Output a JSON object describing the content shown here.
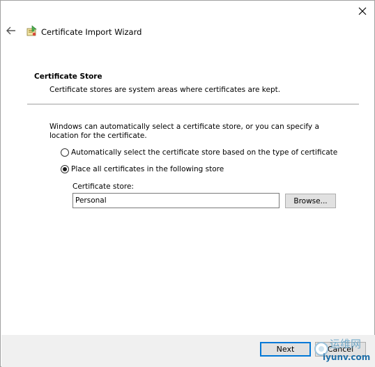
{
  "window": {
    "title": "Certificate Import Wizard",
    "close_icon": "close-icon",
    "back_icon": "back-arrow-icon",
    "wizard_icon": "certificate-wizard-icon"
  },
  "section": {
    "heading": "Certificate Store",
    "description": "Certificate stores are system areas where certificates are kept."
  },
  "body": {
    "intro": "Windows can automatically select a certificate store, or you can specify a location for the certificate.",
    "options": [
      {
        "label": "Automatically select the certificate store based on the type of certificate",
        "selected": false
      },
      {
        "label": "Place all certificates in the following store",
        "selected": true
      }
    ],
    "store_label": "Certificate store:",
    "store_value": "Personal",
    "browse_label": "Browse..."
  },
  "footer": {
    "next_label": "Next",
    "cancel_label": "Cancel"
  },
  "watermark": {
    "text": "运维网",
    "url": "iyunv.com"
  },
  "colors": {
    "accent": "#0078d7",
    "footer_bg": "#f0f0f0",
    "button_bg": "#e1e1e1"
  }
}
